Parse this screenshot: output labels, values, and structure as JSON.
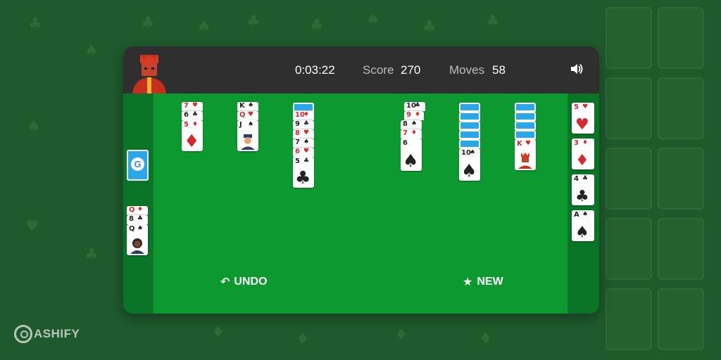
{
  "header": {
    "timer": "0:03:22",
    "score_label": "Score",
    "score_value": "270",
    "moves_label": "Moves",
    "moves_value": "58"
  },
  "stock": {
    "glyph": "G"
  },
  "waste": [
    {
      "rank": "Q",
      "suit": "♦"
    },
    {
      "rank": "8",
      "suit": "♣"
    },
    {
      "rank": "Q",
      "suit": "♠"
    }
  ],
  "tableau": {
    "col1": [
      {
        "rank": "7",
        "suit": "♥"
      },
      {
        "rank": "6",
        "suit": "♣"
      },
      {
        "rank": "5",
        "suit": "♦"
      }
    ],
    "col2": [
      {
        "rank": "K",
        "suit": "♠"
      },
      {
        "rank": "Q",
        "suit": "♥"
      },
      {
        "rank": "J",
        "suit": "♠"
      }
    ],
    "col3": [
      {
        "rank": "10",
        "suit": "♦"
      },
      {
        "rank": "9",
        "suit": "♣"
      },
      {
        "rank": "8",
        "suit": "♥"
      },
      {
        "rank": "7",
        "suit": "♠"
      },
      {
        "rank": "6",
        "suit": "♥"
      },
      {
        "rank": "5",
        "suit": "♣"
      }
    ],
    "col5a": [
      {
        "rank": "10",
        "suit": "♣"
      },
      {
        "rank": "9",
        "suit": "♦"
      }
    ],
    "col5b": [
      {
        "rank": "8",
        "suit": "♠"
      },
      {
        "rank": "7",
        "suit": "♦"
      },
      {
        "rank": "6",
        "suit": "♠"
      }
    ],
    "col6": [
      {
        "rank": "10",
        "suit": "♠"
      }
    ],
    "col7": [
      {
        "rank": "K",
        "suit": "♥"
      }
    ]
  },
  "foundations": [
    {
      "rank": "5",
      "suit": "♥"
    },
    {
      "rank": "3",
      "suit": "♦"
    },
    {
      "rank": "4",
      "suit": "♣"
    },
    {
      "rank": "A",
      "suit": "♠"
    }
  ],
  "buttons": {
    "undo": "UNDO",
    "new": "NEW"
  },
  "icons": {
    "undo": "↶",
    "new": "★",
    "sound": "speaker-icon"
  },
  "brand": {
    "name": "ASHIFY"
  },
  "colors": {
    "table": "#0c9a30",
    "topbar": "#2f2f30",
    "card_back": "#2aa7e8",
    "red_suit": "#d42a2a"
  }
}
